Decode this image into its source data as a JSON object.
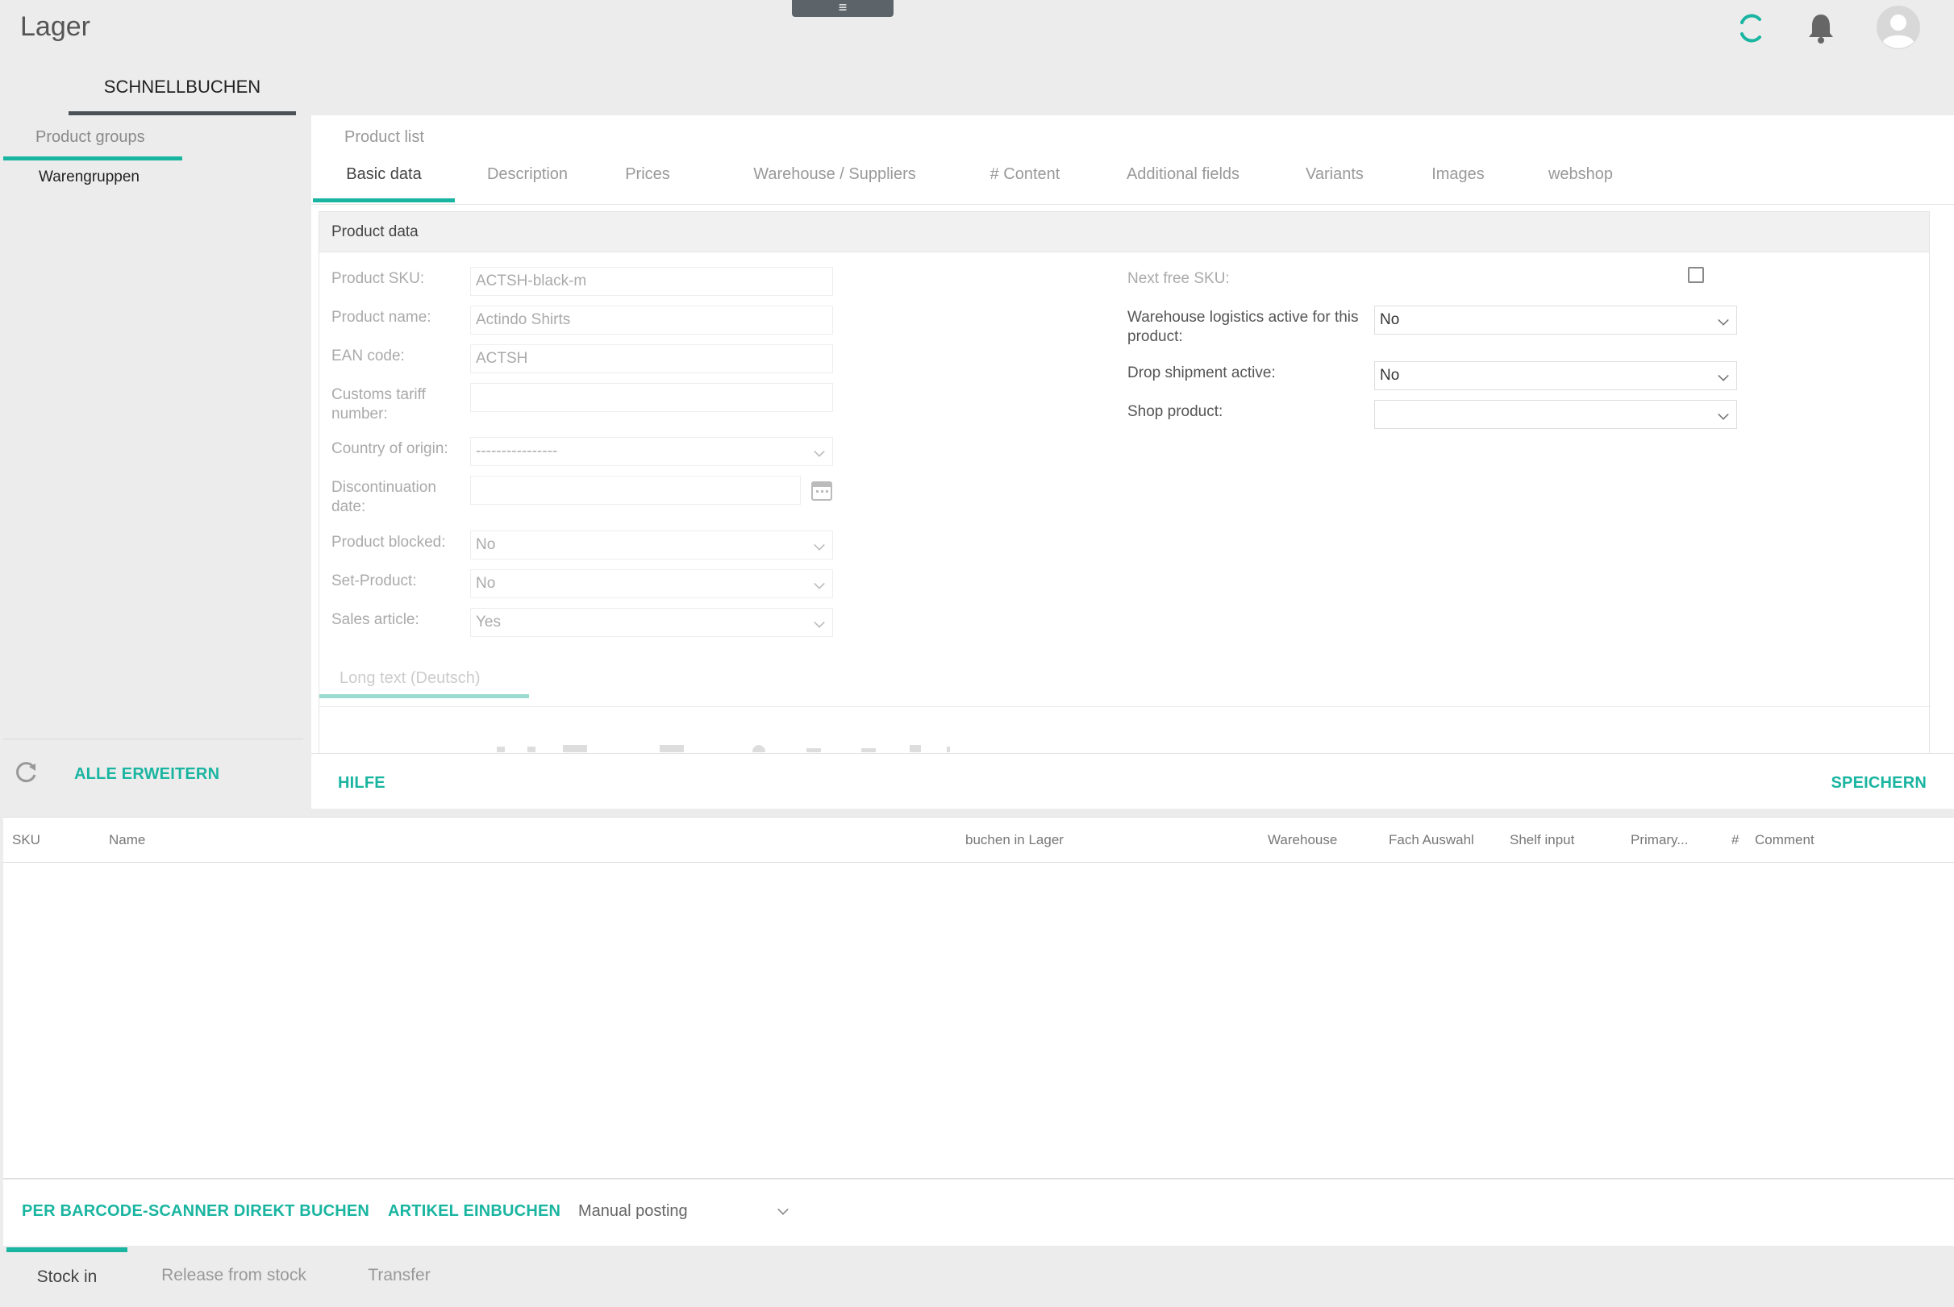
{
  "header": {
    "app_title": "Lager",
    "menu_handle_glyph": "≡",
    "main_tab": "SCHNELLBUCHEN"
  },
  "sidebar": {
    "title": "Product groups",
    "items": [
      "Warengruppen"
    ],
    "expand_all_label": "ALLE ERWEITERN"
  },
  "product": {
    "breadcrumb": "Product list",
    "tabs": [
      "Basic data",
      "Description",
      "Prices",
      "Warehouse / Suppliers",
      "# Content",
      "Additional fields",
      "Variants",
      "Images",
      "webshop"
    ],
    "section_title": "Product data",
    "fields": {
      "sku_label": "Product SKU:",
      "sku_value": "ACTSH-black-m",
      "name_label": "Product name:",
      "name_value": "Actindo Shirts",
      "ean_label": "EAN code:",
      "ean_value": "ACTSH",
      "customs_label": "Customs tariff number:",
      "customs_value": "",
      "origin_label": "Country of origin:",
      "origin_value": "----------------",
      "discontinuation_label": "Discontinuation date:",
      "discontinuation_value": "",
      "blocked_label": "Product blocked:",
      "blocked_value": "No",
      "set_label": "Set-Product:",
      "set_value": "No",
      "sales_label": "Sales article:",
      "sales_value": "Yes",
      "next_sku_label": "Next free SKU:",
      "warehouse_logistics_label": "Warehouse logistics active for this product:",
      "warehouse_logistics_value": "No",
      "drop_shipment_label": "Drop shipment active:",
      "drop_shipment_value": "No",
      "shop_product_label": "Shop product:",
      "shop_product_value": ""
    },
    "long_text_tab": "Long text (Deutsch)",
    "help_label": "HILFE",
    "save_label": "SPEICHERN"
  },
  "grid": {
    "columns": [
      "SKU",
      "Name",
      "buchen in Lager",
      "Warehouse",
      "Fach Auswahl",
      "Shelf input",
      "Primary...",
      "#",
      "Comment"
    ]
  },
  "actions": {
    "barcode_label": "PER BARCODE-SCANNER DIREKT BUCHEN",
    "book_label": "ARTIKEL EINBUCHEN",
    "posting_mode": "Manual posting"
  },
  "bottom_tabs": [
    "Stock in",
    "Release from stock",
    "Transfer"
  ],
  "colors": {
    "accent": "#1ab5a1",
    "handle": "#5c6469"
  }
}
